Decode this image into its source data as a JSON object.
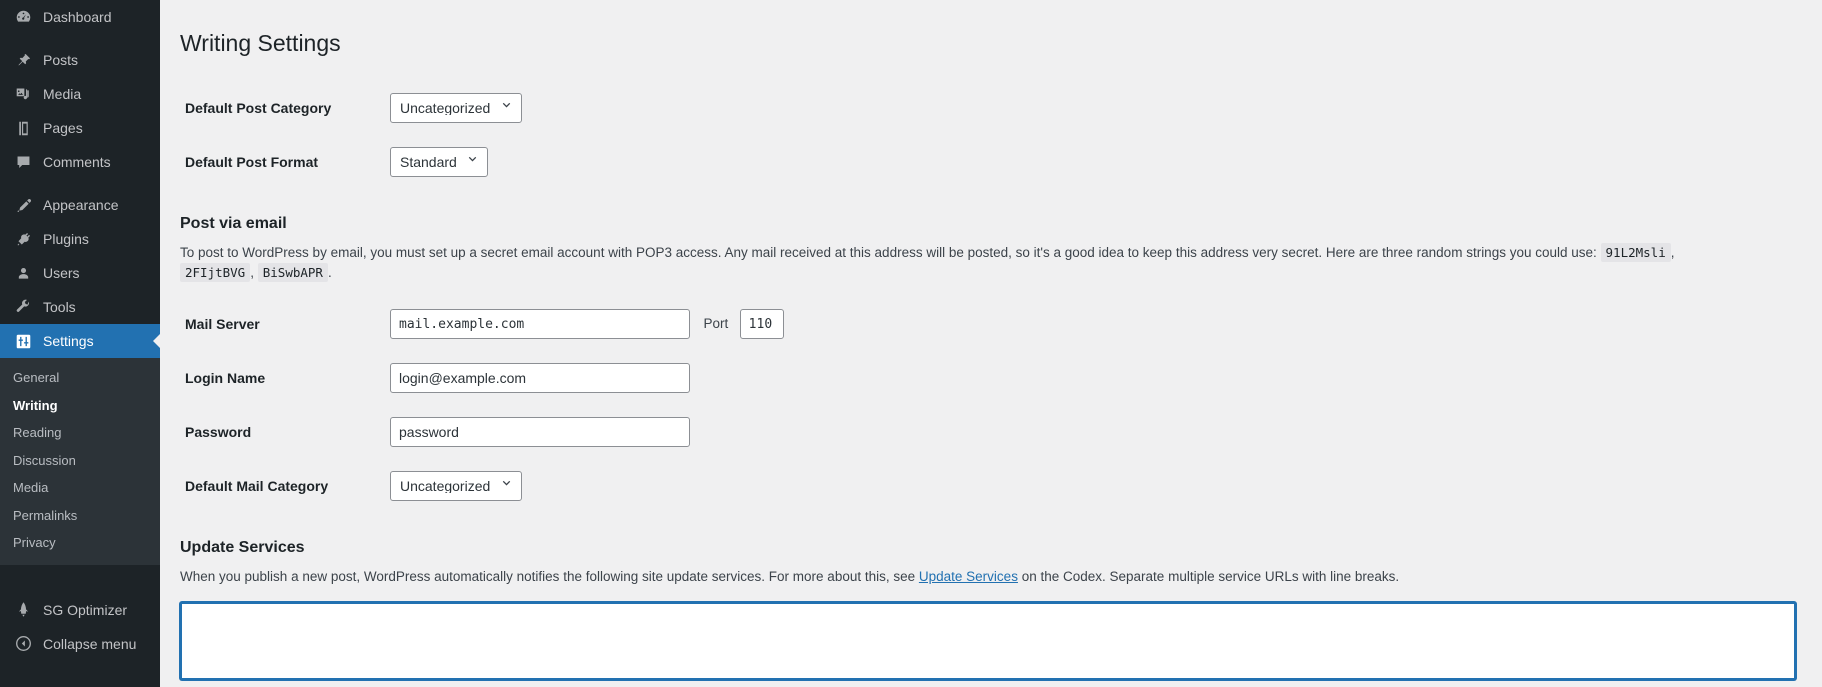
{
  "sidebar": {
    "primary": [
      {
        "label": "Dashboard",
        "icon": "dashboard-icon"
      },
      {
        "label": "Posts",
        "icon": "pin-icon"
      },
      {
        "label": "Media",
        "icon": "media-icon"
      },
      {
        "label": "Pages",
        "icon": "page-icon"
      },
      {
        "label": "Comments",
        "icon": "comment-icon"
      },
      {
        "label": "Appearance",
        "icon": "brush-icon"
      },
      {
        "label": "Plugins",
        "icon": "plug-icon"
      },
      {
        "label": "Users",
        "icon": "user-icon"
      },
      {
        "label": "Tools",
        "icon": "wrench-icon"
      },
      {
        "label": "Settings",
        "icon": "settings-icon"
      }
    ],
    "submenu": [
      {
        "label": "General",
        "current": false
      },
      {
        "label": "Writing",
        "current": true
      },
      {
        "label": "Reading",
        "current": false
      },
      {
        "label": "Discussion",
        "current": false
      },
      {
        "label": "Media",
        "current": false
      },
      {
        "label": "Permalinks",
        "current": false
      },
      {
        "label": "Privacy",
        "current": false
      }
    ],
    "bottom": [
      {
        "label": "SG Optimizer",
        "icon": "rocket-icon"
      },
      {
        "label": "Collapse menu",
        "icon": "collapse-arrow-icon"
      }
    ],
    "active_item": "Settings",
    "accent_color": "#2271b1",
    "background_color": "#1d2327",
    "submenu_background": "#2c3338"
  },
  "page": {
    "title": "Writing Settings"
  },
  "fields": {
    "default_post_category": {
      "label": "Default Post Category",
      "value": "Uncategorized"
    },
    "default_post_format": {
      "label": "Default Post Format",
      "value": "Standard"
    },
    "mail_server": {
      "label": "Mail Server",
      "value": "mail.example.com",
      "port_label": "Port",
      "port_value": "110"
    },
    "login_name": {
      "label": "Login Name",
      "value": "login@example.com"
    },
    "password": {
      "label": "Password",
      "value": "password"
    },
    "default_mail_category": {
      "label": "Default Mail Category",
      "value": "Uncategorized"
    }
  },
  "post_via_email": {
    "heading": "Post via email",
    "description_before": "To post to WordPress by email, you must set up a secret email account with POP3 access. Any mail received at this address will be posted, so it's a good idea to keep this address very secret. Here are three random strings you could use:",
    "random_strings": [
      "91L2Msli",
      "2FIjtBVG",
      "BiSwbAPR"
    ],
    "separator": ",",
    "terminator": "."
  },
  "update_services": {
    "heading": "Update Services",
    "description_part1": "When you publish a new post, WordPress automatically notifies the following site update services. For more about this, see",
    "link_text": "Update Services",
    "description_part2": "on the Codex. Separate multiple service URLs with line breaks.",
    "textarea_value": "",
    "textarea_focused": true,
    "focus_color": "#2271b1"
  }
}
